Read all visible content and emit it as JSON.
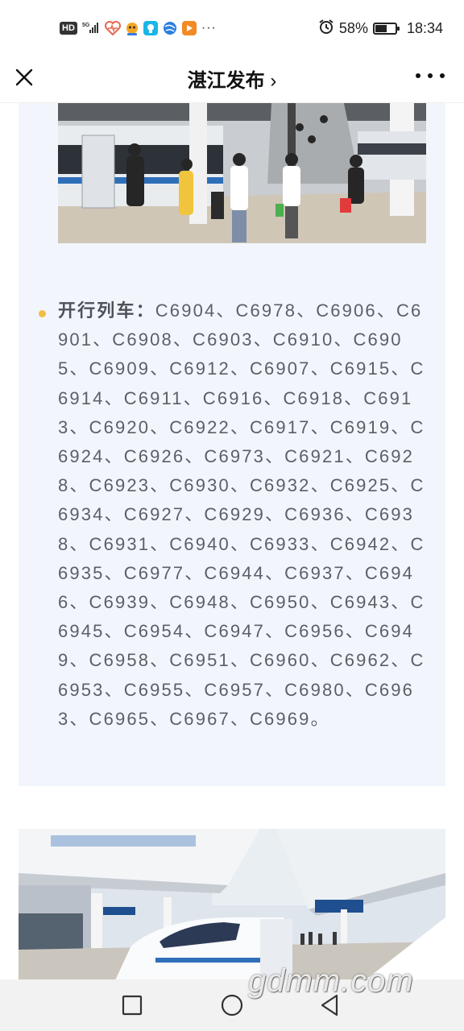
{
  "status_bar": {
    "network": "HD",
    "signal": "5G",
    "battery_percent": "58%",
    "battery_level": 0.58,
    "time": "18:34",
    "more_dots": "···",
    "icons": [
      "hd-icon",
      "signal-icon",
      "health-heart-icon",
      "app-face-icon",
      "lightbulb-app-icon",
      "globe-app-icon",
      "video-app-icon",
      "alarm-icon",
      "battery-icon"
    ]
  },
  "nav": {
    "title": "湛江发布",
    "chevron": "›",
    "icons": [
      "close-icon",
      "more-icon"
    ]
  },
  "article": {
    "list_label": "开行列车：",
    "list_value": "C6904、C6978、C6906、C6901、C6908、C6903、C6910、C6905、C6909、C6912、C6907、C6915、C6914、C6911、C6916、C6918、C6913、C6920、C6922、C6917、C6919、C6924、C6926、C6973、C6921、C6928、C6923、C6930、C6932、C6925、C6934、C6927、C6929、C6936、C6938、C6931、C6940、C6933、C6942、C6935、C6977、C6944、C6937、C6946、C6939、C6948、C6950、C6943、C6945、C6954、C6947、C6956、C6949、C6958、C6951、C6960、C6962、C6953、C6955、C6957、C6980、C6963、C6965、C6967、C6969。",
    "accent_color": "#f3bd45",
    "card_bg": "#f2f6fc"
  },
  "watermark": "gdmm.com",
  "system_nav": {
    "icons": [
      "recents-square-icon",
      "home-circle-icon",
      "back-triangle-icon"
    ]
  }
}
